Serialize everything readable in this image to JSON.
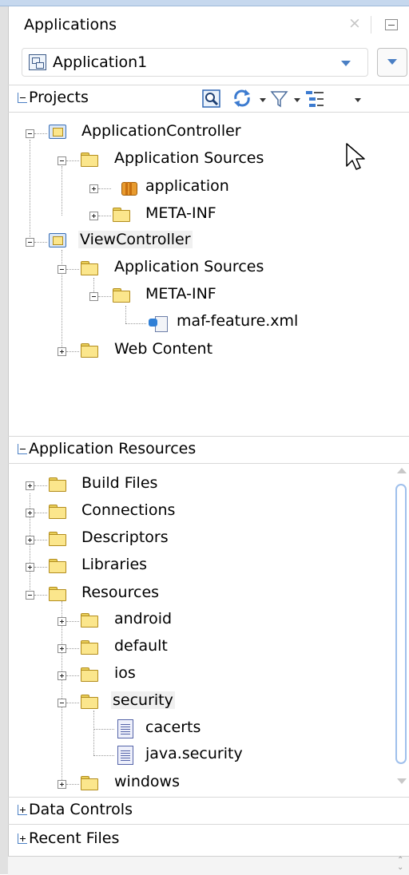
{
  "panel": {
    "title": "Applications",
    "close_symbol": "×"
  },
  "application_selector": {
    "value": "Application1"
  },
  "projects": {
    "header": "Projects",
    "toolbar": [
      "navigate-icon",
      "refresh-icon",
      "filter-icon",
      "working-sets-icon"
    ],
    "tree": [
      {
        "label": "ApplicationController",
        "icon": "project-icon",
        "state": "expanded"
      },
      {
        "label": "Application Sources",
        "icon": "folder-icon",
        "state": "expanded"
      },
      {
        "label": "application",
        "icon": "package-icon",
        "state": "collapsed"
      },
      {
        "label": "META-INF",
        "icon": "folder-icon",
        "state": "collapsed"
      },
      {
        "label": "ViewController",
        "icon": "project-icon",
        "state": "expanded",
        "selected": true
      },
      {
        "label": "Application Sources",
        "icon": "folder-icon",
        "state": "expanded"
      },
      {
        "label": "META-INF",
        "icon": "folder-icon",
        "state": "expanded"
      },
      {
        "label": "maf-feature.xml",
        "icon": "xml-file-icon"
      },
      {
        "label": "Web Content",
        "icon": "folder-icon",
        "state": "collapsed"
      }
    ]
  },
  "app_resources": {
    "header": "Application Resources",
    "tree": [
      {
        "label": "Build Files",
        "icon": "folder-icon",
        "state": "collapsed"
      },
      {
        "label": "Connections",
        "icon": "folder-icon",
        "state": "collapsed"
      },
      {
        "label": "Descriptors",
        "icon": "folder-icon",
        "state": "collapsed"
      },
      {
        "label": "Libraries",
        "icon": "folder-icon",
        "state": "collapsed"
      },
      {
        "label": "Resources",
        "icon": "folder-icon",
        "state": "expanded"
      },
      {
        "label": "android",
        "icon": "folder-icon",
        "state": "collapsed"
      },
      {
        "label": "default",
        "icon": "folder-icon",
        "state": "collapsed"
      },
      {
        "label": "ios",
        "icon": "folder-icon",
        "state": "collapsed"
      },
      {
        "label": "security",
        "icon": "folder-icon",
        "state": "expanded",
        "selected": true
      },
      {
        "label": "cacerts",
        "icon": "file-icon"
      },
      {
        "label": "java.security",
        "icon": "file-icon"
      },
      {
        "label": "windows",
        "icon": "folder-icon",
        "state": "collapsed"
      }
    ]
  },
  "data_controls": {
    "header": "Data Controls",
    "state": "collapsed"
  },
  "recent_files": {
    "header": "Recent Files",
    "state": "collapsed"
  }
}
